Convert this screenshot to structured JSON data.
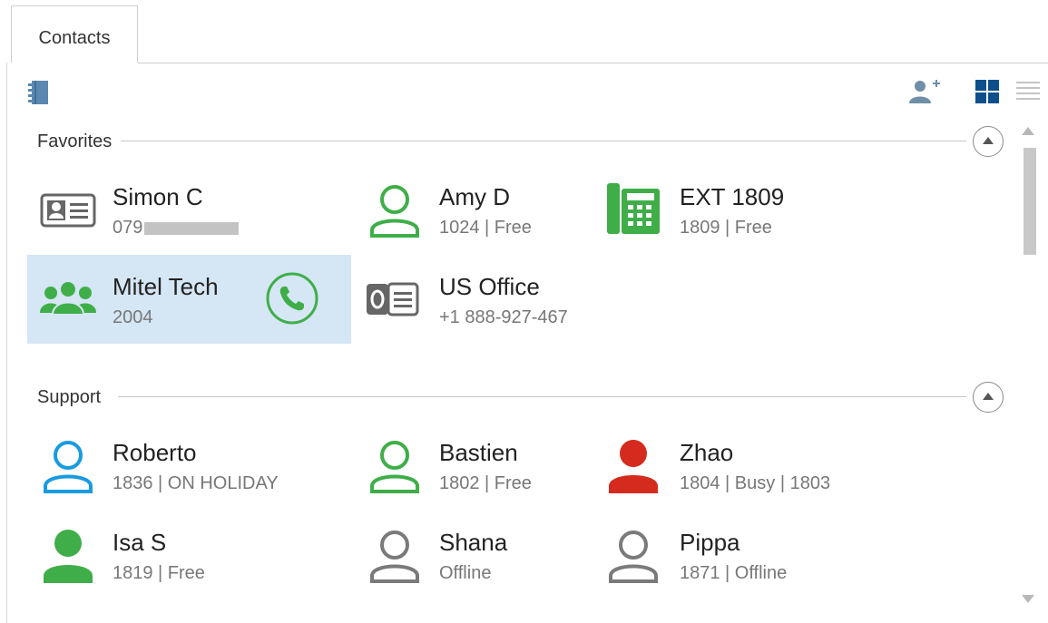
{
  "tabs": [
    {
      "label": "Contacts"
    }
  ],
  "sections": [
    {
      "title": "Favorites",
      "contacts": [
        {
          "name": "Simon C",
          "detail": "079",
          "icon": "contact-card-icon",
          "detail_redacted": true
        },
        {
          "name": "Amy D",
          "detail": "1024  |  Free",
          "icon": "person-outline-green-icon"
        },
        {
          "name": "EXT 1809",
          "detail": "1809  |  Free",
          "icon": "desk-phone-icon"
        },
        {
          "name": "Mitel Tech",
          "detail": "2004",
          "icon": "group-icon",
          "selected": true,
          "action_icon": "phone-call-icon"
        },
        {
          "name": "US Office",
          "detail": "+1 888-927-467",
          "icon": "outlook-card-icon"
        }
      ]
    },
    {
      "title": "Support",
      "contacts": [
        {
          "name": "Roberto",
          "detail": "1836  |  ON HOLIDAY",
          "icon": "person-outline-blue-icon"
        },
        {
          "name": "Bastien",
          "detail": "1802  |  Free",
          "icon": "person-outline-green-icon"
        },
        {
          "name": "Zhao",
          "detail": "1804  |  Busy  |  1803",
          "icon": "person-filled-red-icon"
        },
        {
          "name": "Isa S",
          "detail": "1819  |  Free",
          "icon": "person-filled-green-icon"
        },
        {
          "name": "Shana",
          "detail": "Offline",
          "icon": "person-outline-gray-icon"
        },
        {
          "name": "Pippa",
          "detail": "1871  |  Offline",
          "icon": "person-outline-gray-icon"
        }
      ]
    }
  ],
  "toolbar": {
    "left_icon": "phonebook-icon",
    "right_icons": [
      "add-contact-icon",
      "grid-view-icon",
      "list-view-icon"
    ]
  },
  "colors": {
    "green": "#3fae49",
    "blue": "#1a9be0",
    "red": "#d52b1e",
    "gray": "#7a7a7a",
    "selected_bg": "#d5e6f5",
    "accent_dark_blue": "#0d4f8b"
  }
}
